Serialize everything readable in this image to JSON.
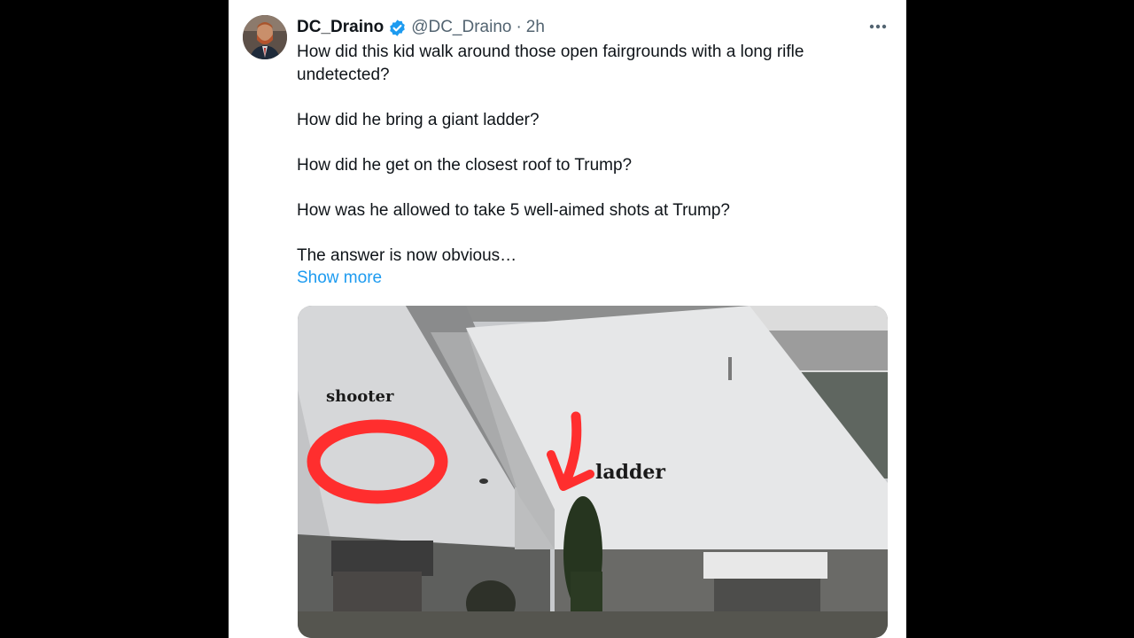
{
  "tweet": {
    "author": {
      "display_name": "DC_Draino",
      "handle": "@DC_Draino",
      "verified": true,
      "avatar_icon": "profile-photo"
    },
    "separator": "·",
    "time": "2h",
    "more_icon": "ellipsis-icon",
    "lines": [
      "How did this kid walk around those open fairgrounds with a long rifle undetected?",
      "How did he bring a giant ladder?",
      "How did he get on the closest roof to Trump?",
      "How was he allowed to take 5 well-aimed shots at Trump?",
      "The answer is now obvious…"
    ],
    "show_more": "Show more",
    "media": {
      "annotation_shooter": "shooter",
      "annotation_ladder": "ladder"
    }
  },
  "colors": {
    "background": "#000000",
    "card": "#ffffff",
    "text": "#0f1419",
    "secondary": "#536471",
    "link": "#1d9bf0",
    "verified": "#1d9bf0",
    "annotation": "#ff2e2e"
  }
}
